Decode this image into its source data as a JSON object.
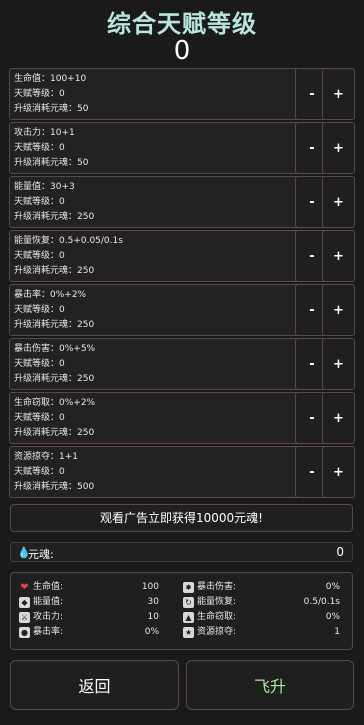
{
  "header": {
    "title": "综合天赋等级",
    "total_level": "0"
  },
  "talents": [
    {
      "name_line": "生命值：100+10",
      "level_line": "天赋等级：0",
      "cost_line": "升级消耗元魂：50"
    },
    {
      "name_line": "攻击力：10+1",
      "level_line": "天赋等级：0",
      "cost_line": "升级消耗元魂：50"
    },
    {
      "name_line": "能量值：30+3",
      "level_line": "天赋等级：0",
      "cost_line": "升级消耗元魂：250"
    },
    {
      "name_line": "能量恢复：0.5+0.05/0.1s",
      "level_line": "天赋等级：0",
      "cost_line": "升级消耗元魂：250"
    },
    {
      "name_line": "暴击率：0%+2%",
      "level_line": "天赋等级：0",
      "cost_line": "升级消耗元魂：250"
    },
    {
      "name_line": "暴击伤害：0%+5%",
      "level_line": "天赋等级：0",
      "cost_line": "升级消耗元魂：250"
    },
    {
      "name_line": "生命窃取：0%+2%",
      "level_line": "天赋等级：0",
      "cost_line": "升级消耗元魂：250"
    },
    {
      "name_line": "资源掠夺：1+1",
      "level_line": "天赋等级：0",
      "cost_line": "升级消耗元魂：500"
    }
  ],
  "buttons": {
    "minus": "-",
    "plus": "+",
    "ad": "观看广告立即获得10000元魂!",
    "back": "返回",
    "ascend": "飞升"
  },
  "currency": {
    "label": "元魂:",
    "value": "0",
    "icon": "water-drop-icon"
  },
  "stats": {
    "left": [
      {
        "label": "生命值:",
        "value": "100",
        "icon": "heart-icon"
      },
      {
        "label": "能量值:",
        "value": "30",
        "icon": "energy-icon"
      },
      {
        "label": "攻击力:",
        "value": "10",
        "icon": "attack-icon"
      },
      {
        "label": "暴击率:",
        "value": "0%",
        "icon": "crit-rate-icon"
      }
    ],
    "right": [
      {
        "label": "暴击伤害:",
        "value": "0%",
        "icon": "crit-damage-icon"
      },
      {
        "label": "能量恢复:",
        "value": "0.5/0.1s",
        "icon": "energy-regen-icon"
      },
      {
        "label": "生命窃取:",
        "value": "0%",
        "icon": "lifesteal-icon"
      },
      {
        "label": "资源掠夺:",
        "value": "1",
        "icon": "resource-plunder-icon"
      }
    ]
  },
  "colors": {
    "title": "#b9e6dc",
    "ascend": "#a9e6a0",
    "border": "#5a4848",
    "background": "#1a1a1b"
  }
}
